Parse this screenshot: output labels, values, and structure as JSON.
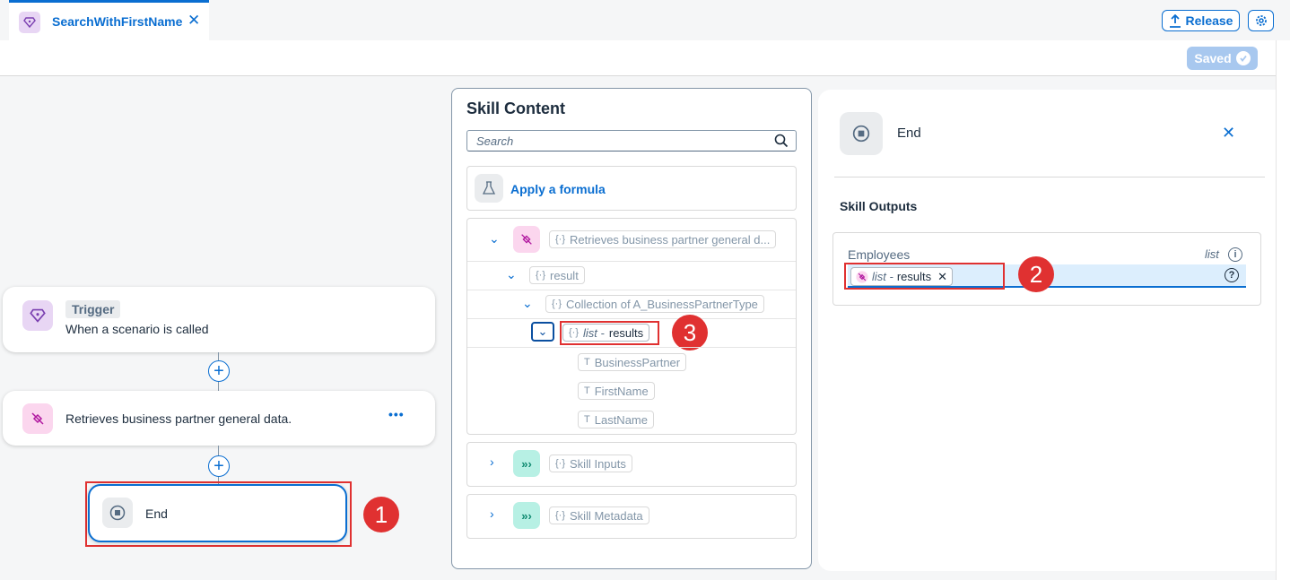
{
  "tab": {
    "title": "SearchWithFirstName",
    "icon": "diamond-skill-icon"
  },
  "header": {
    "release_label": "Release",
    "saved_label": "Saved"
  },
  "canvas": {
    "trigger": {
      "tag": "Trigger",
      "text": "When a scenario is called"
    },
    "retrieve": {
      "text": "Retrieves business partner general data.",
      "menu": "•••"
    },
    "end": {
      "text": "End"
    },
    "plus": "+"
  },
  "badges": [
    "1",
    "2",
    "3"
  ],
  "skill_content": {
    "title": "Skill Content",
    "search_placeholder": "Search",
    "apply_formula": "Apply a formula",
    "tree": {
      "action": "Retrieves business partner general d...",
      "result": "result",
      "collection": "Collection of A_BusinessPartnerType",
      "list_type": "list -",
      "list_name": "results",
      "fields": [
        "BusinessPartner",
        "FirstName",
        "LastName"
      ]
    },
    "skill_inputs": "Skill Inputs",
    "skill_metadata": "Skill Metadata"
  },
  "end_panel": {
    "title": "End",
    "section_title": "Skill Outputs",
    "output_label": "Employees",
    "output_type": "list",
    "token_type": "list -",
    "token_name": "results"
  },
  "colors": {
    "accent": "#0a6ed1",
    "annotation": "#e03131"
  }
}
